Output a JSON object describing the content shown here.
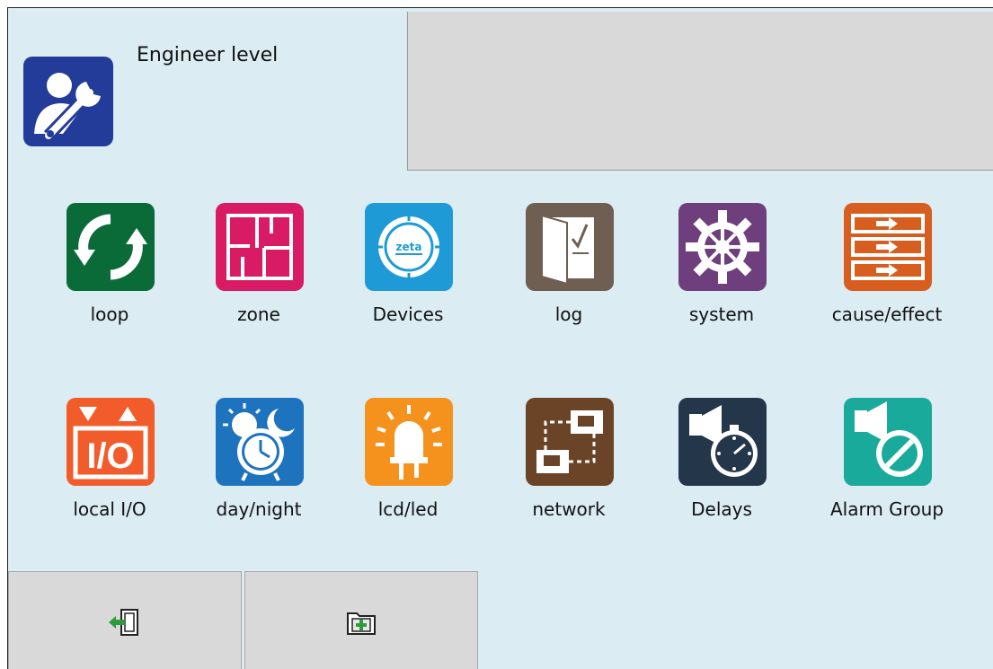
{
  "header": {
    "title": "Engineer level",
    "icon": "engineer-wrench-icon",
    "icon_color": "#243c99"
  },
  "menu": [
    {
      "label": "loop",
      "icon": "loop-refresh-icon",
      "color": "#0a6b39"
    },
    {
      "label": "zone",
      "icon": "zone-floorplan-icon",
      "color": "#d81b64"
    },
    {
      "label": "Devices",
      "icon": "devices-zeta-icon",
      "color": "#1e9bd7",
      "logo_text": "zeta"
    },
    {
      "label": "log",
      "icon": "log-book-icon",
      "color": "#6e5f52"
    },
    {
      "label": "system",
      "icon": "system-gear-icon",
      "color": "#6e3f7c"
    },
    {
      "label": "cause/effect",
      "icon": "cause-effect-icon",
      "color": "#d85e1f"
    },
    {
      "label": "local I/O",
      "icon": "local-io-icon",
      "color": "#f25c2a",
      "icon_text": "I/O"
    },
    {
      "label": "day/night",
      "icon": "day-night-clock-icon",
      "color": "#1e73be"
    },
    {
      "label": "lcd/led",
      "icon": "lcd-led-bulb-icon",
      "color": "#f5921e"
    },
    {
      "label": "network",
      "icon": "network-icon",
      "color": "#6b4326"
    },
    {
      "label": "Delays",
      "icon": "delays-sounder-timer-icon",
      "color": "#24364a"
    },
    {
      "label": "Alarm Group",
      "icon": "alarm-group-icon",
      "color": "#1aaa9b"
    }
  ],
  "bottom_buttons": [
    {
      "icon": "exit-door-icon",
      "accent": "#2e9b3a"
    },
    {
      "icon": "add-folder-icon",
      "accent": "#2e9b3a"
    }
  ]
}
